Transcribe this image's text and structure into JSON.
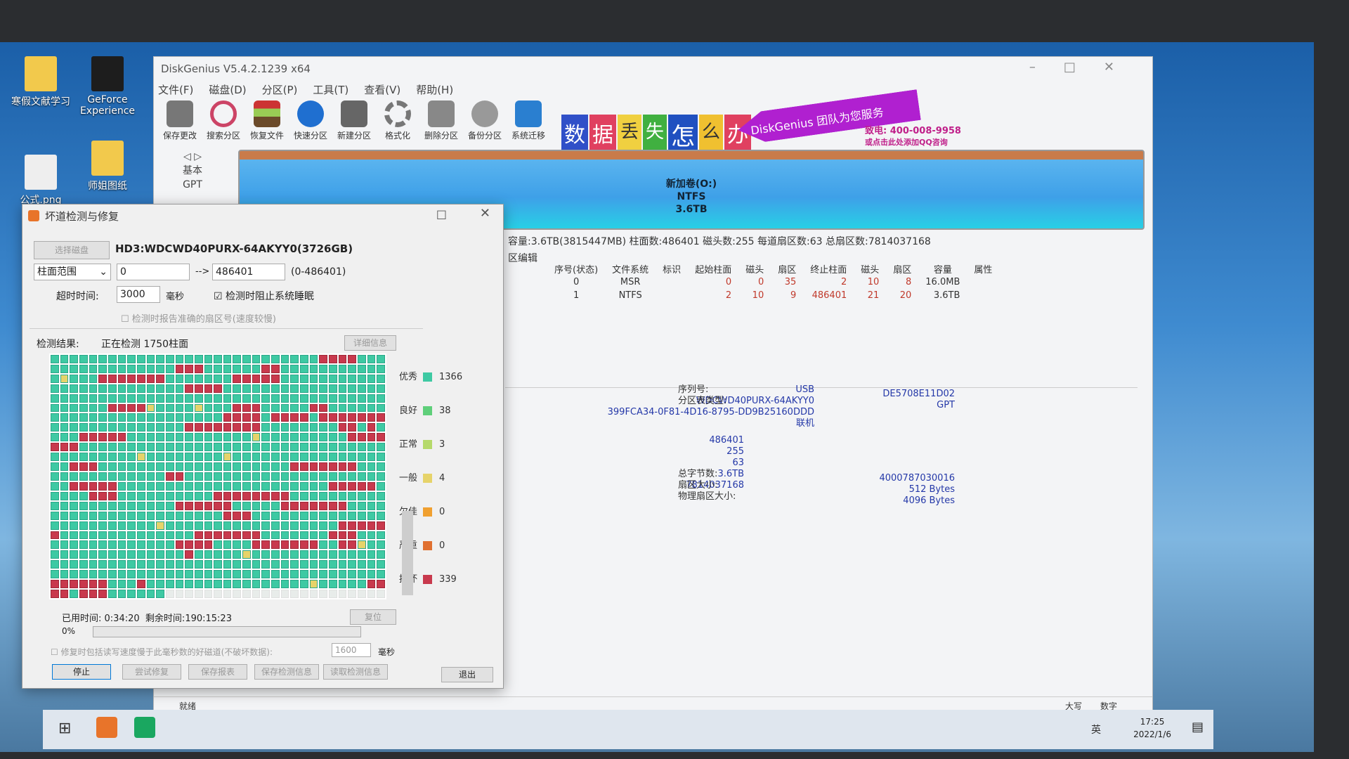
{
  "desktop": {
    "icons": [
      "寒假文献学习",
      "GeForce Experience",
      "公式.png",
      "师姐图纸"
    ]
  },
  "app": {
    "title": "DiskGenius V5.4.2.1239 x64",
    "menu": [
      "文件(F)",
      "磁盘(D)",
      "分区(P)",
      "工具(T)",
      "查看(V)",
      "帮助(H)"
    ],
    "toolbar": [
      "保存更改",
      "搜索分区",
      "恢复文件",
      "快速分区",
      "新建分区",
      "格式化",
      "删除分区",
      "备份分区",
      "系统迁移"
    ],
    "banner": {
      "chars": [
        "数",
        "据",
        "丢",
        "失",
        "怎",
        "么",
        "办"
      ],
      "slogan": "DiskGenius 团队为您服务",
      "phone": "致电: 400-008-9958",
      "qq": "或点击此处添加QQ咨询"
    },
    "disk_nav": {
      "type": "基本",
      "scheme": "GPT"
    },
    "partition_bar": {
      "name": "新加卷(O:)",
      "fs": "NTFS",
      "size": "3.6TB"
    },
    "disk_info": "容量:3.6TB(3815447MB) 柱面数:486401 磁头数:255 每道扇区数:63 总扇区数:7814037168",
    "tab": "区编辑",
    "table": {
      "headers": [
        "序号(状态)",
        "文件系统",
        "标识",
        "起始柱面",
        "磁头",
        "扇区",
        "终止柱面",
        "磁头",
        "扇区",
        "容量",
        "属性"
      ],
      "rows": [
        [
          "0",
          "MSR",
          "",
          "0",
          "0",
          "35",
          "2",
          "10",
          "8",
          "16.0MB",
          ""
        ],
        [
          "1",
          "NTFS",
          "",
          "2",
          "10",
          "9",
          "486401",
          "21",
          "20",
          "3.6TB",
          ""
        ]
      ]
    },
    "details": {
      "interface": "USB",
      "model": "WDCWD40PURX-64AKYY0",
      "guid": "399FCA34-0F81-4D16-8795-DD9B25160DDD",
      "status": "联机",
      "serial_label": "序列号:",
      "serial": "DE5708E11D02",
      "ptype_label": "分区表类型:",
      "ptype": "GPT",
      "cyl": "486401",
      "heads": "255",
      "spt": "63",
      "cap": "3.6TB",
      "sectors": "7814037168",
      "total_bytes_label": "总字节数:",
      "total_bytes": "4000787030016",
      "sector_size_label": "扇区大小:",
      "sector_size": "512 Bytes",
      "phys_label": "物理扇区大小:",
      "phys": "4096 Bytes"
    },
    "status": {
      "ready": "就绪",
      "caps": "大写",
      "num": "数字"
    }
  },
  "dialog": {
    "title": "坏道检测与修复",
    "select_disk": "选择磁盘",
    "disk": "HD3:WDCWD40PURX-64AKYY0(3726GB)",
    "range_mode": "柱面范围",
    "from": "0",
    "arrow": "-->",
    "to": "486401",
    "range_hint": "(0-486401)",
    "timeout_label": "超时时间:",
    "timeout": "3000",
    "ms": "毫秒",
    "prevent_sleep": "检测时阻止系统睡眠",
    "prevent_sleep_checked": true,
    "report_exact": "检测时报告准确的扇区号(速度较慢)",
    "result_label": "检测结果:",
    "progress_text": "正在检测 1750柱面",
    "details_btn": "详细信息",
    "legend": [
      {
        "label": "优秀",
        "count": "1366",
        "color": "#3ec9a3"
      },
      {
        "label": "良好",
        "count": "38",
        "color": "#5fcf7a"
      },
      {
        "label": "正常",
        "count": "3",
        "color": "#b5d96a"
      },
      {
        "label": "一般",
        "count": "4",
        "color": "#e6d36a"
      },
      {
        "label": "欠佳",
        "count": "0",
        "color": "#f0a030"
      },
      {
        "label": "严重",
        "count": "0",
        "color": "#e07030"
      },
      {
        "label": "损坏",
        "count": "339",
        "color": "#c8394d"
      }
    ],
    "elapsed_label": "已用时间:",
    "elapsed": "0:34:20",
    "remaining_label": "剩余时间:",
    "remaining": "190:15:23",
    "reset": "复位",
    "percent": "0%",
    "progress": 0,
    "repair_opt": "修复时包括读写速度慢于此毫秒数的好磁道(不破坏数据):",
    "repair_ms": "1600",
    "repair_unit": "毫秒",
    "buttons": [
      "停止",
      "尝试修复",
      "保存报表",
      "保存检测信息",
      "读取检测信息"
    ],
    "exit": "退出"
  },
  "taskbar": {
    "time": "17:25",
    "date": "2022/1/6",
    "ime": "英"
  }
}
